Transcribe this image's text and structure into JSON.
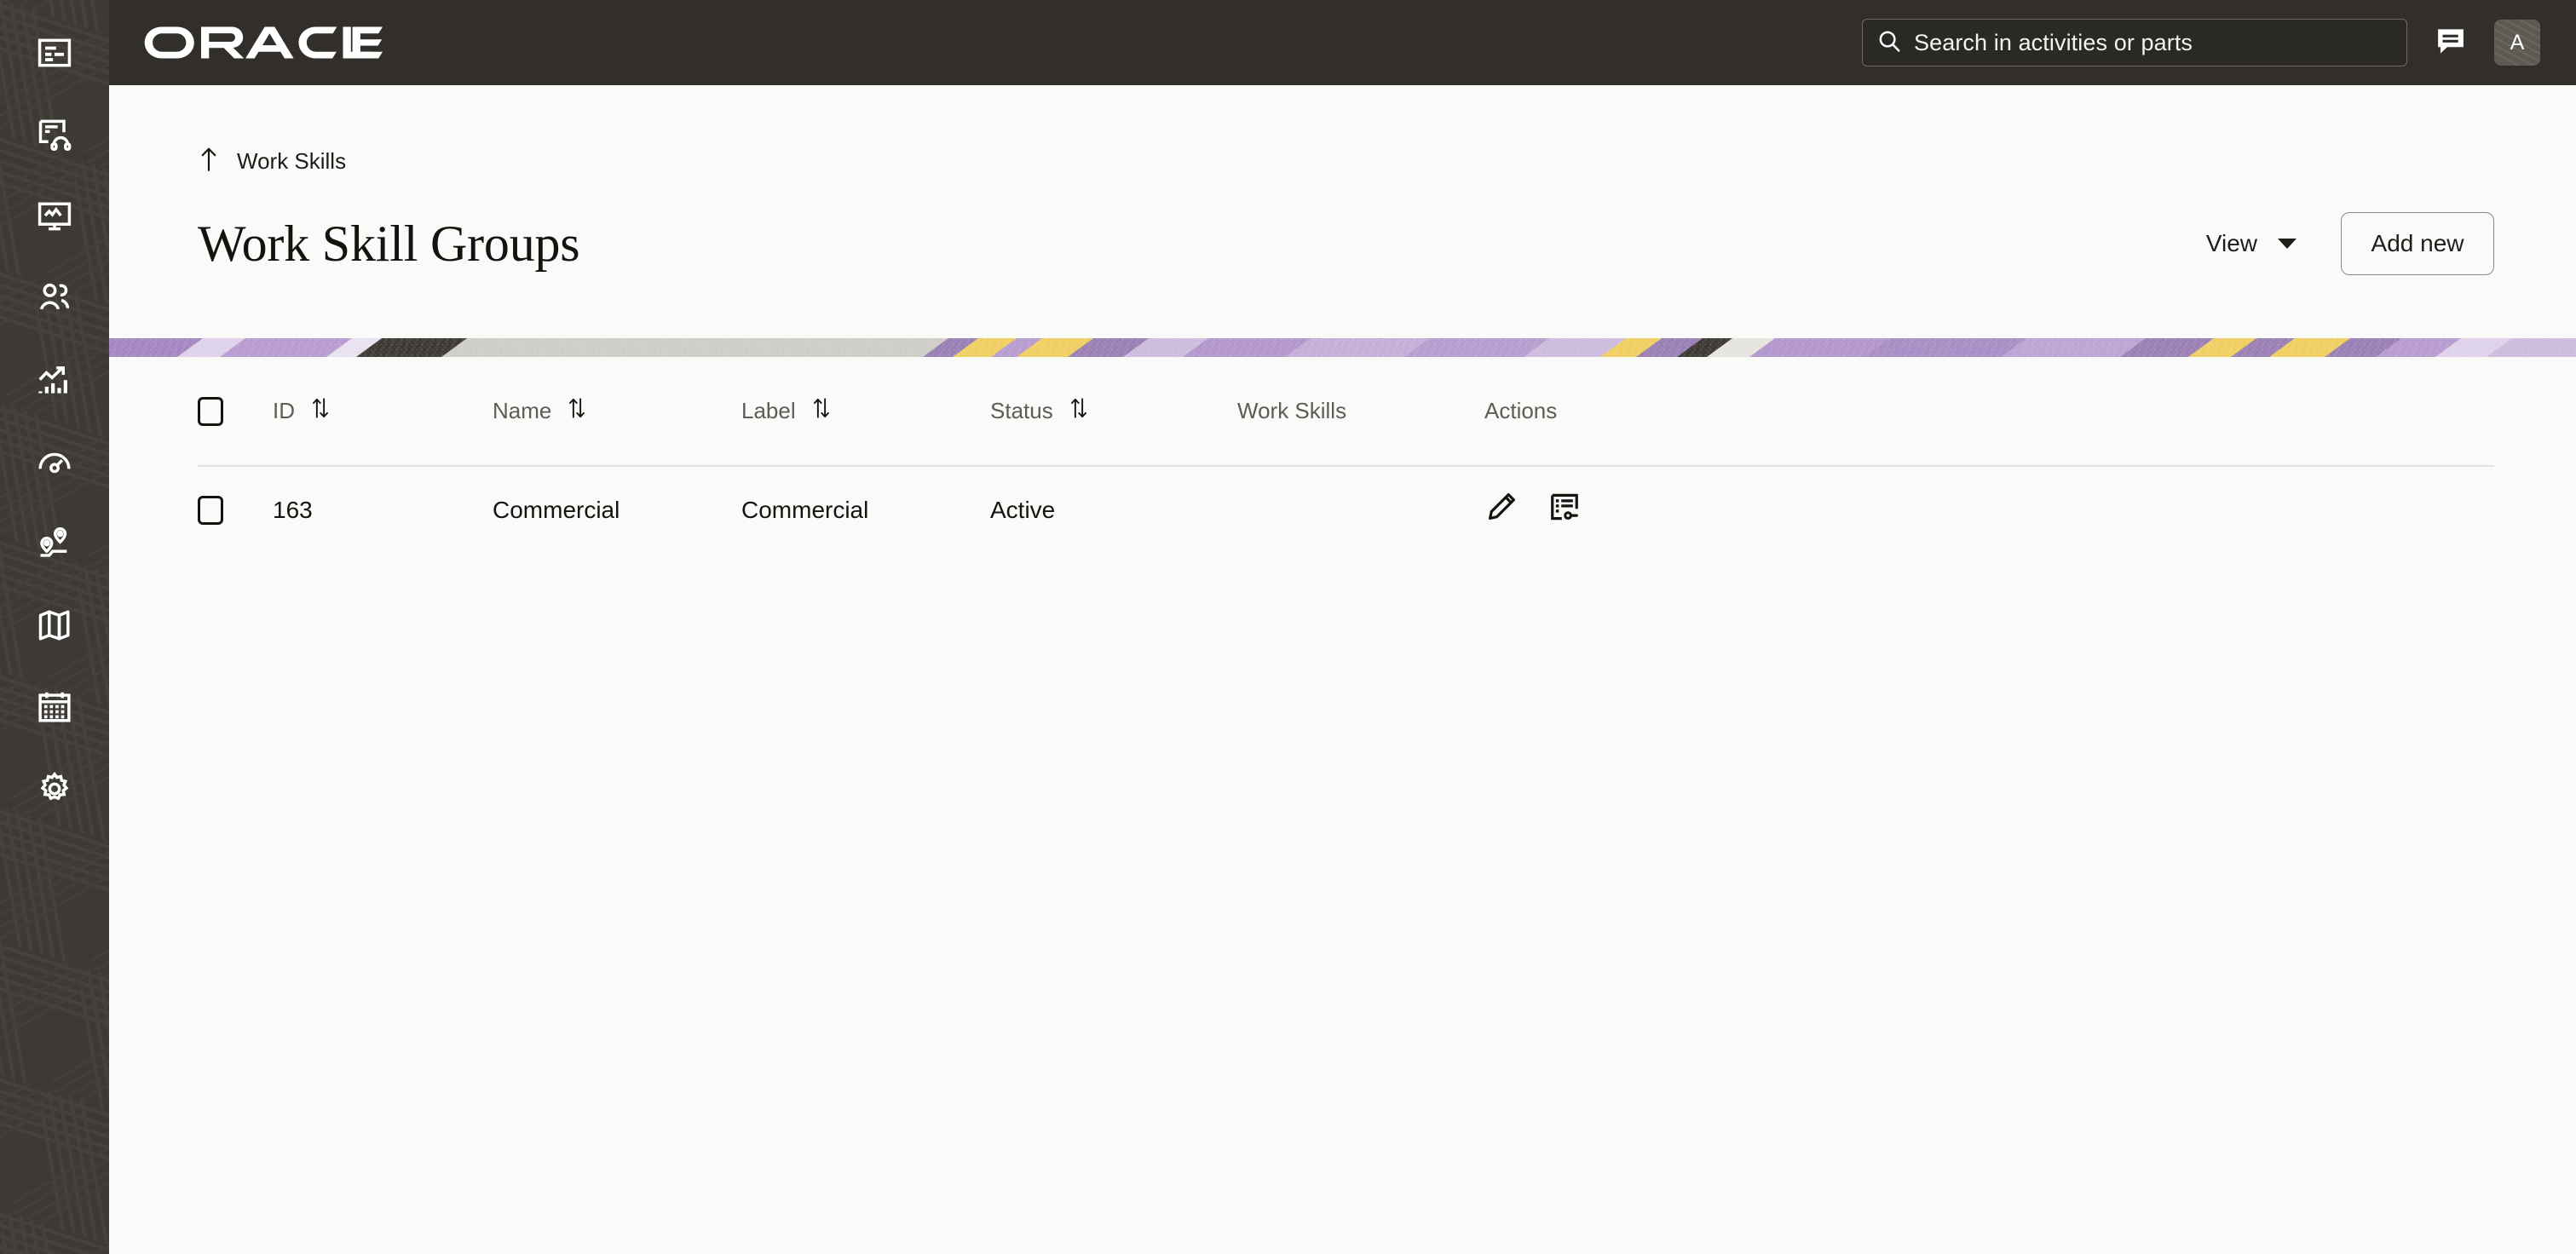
{
  "theme": {
    "sidebar_bg": "#3d3a35",
    "topbar_bg": "#322f2b",
    "page_bg": "#fafaf9",
    "text_primary": "#15130f",
    "text_muted": "#5f5c57",
    "banner_purple": "#9a7fb4",
    "banner_lavender": "#cdbcdd",
    "banner_yellow": "#f0cf62",
    "banner_dark": "#3c3935",
    "banner_gray": "#cfcdc8"
  },
  "sidebar": {
    "items": [
      {
        "name": "dispatch-console",
        "icon": "dispatch-icon"
      },
      {
        "name": "service-requests",
        "icon": "headset-document-icon"
      },
      {
        "name": "monitoring",
        "icon": "monitor-activity-icon"
      },
      {
        "name": "resources",
        "icon": "users-icon"
      },
      {
        "name": "analytics",
        "icon": "trending-chart-icon"
      },
      {
        "name": "performance",
        "icon": "gauge-icon"
      },
      {
        "name": "routing",
        "icon": "route-pins-icon"
      },
      {
        "name": "map",
        "icon": "map-icon"
      },
      {
        "name": "calendar",
        "icon": "calendar-icon"
      },
      {
        "name": "configuration",
        "icon": "gear-icon"
      }
    ]
  },
  "topbar": {
    "brand": "ORACLE",
    "search": {
      "placeholder": "Search in activities or parts",
      "value": "Search in activities or parts",
      "icon": "search-icon"
    },
    "chat": {
      "icon": "chat-icon",
      "label": "Collaboration"
    },
    "avatar": {
      "initial": "A",
      "label": "User menu"
    }
  },
  "page": {
    "breadcrumb": {
      "icon": "arrow-up-icon",
      "label": "Work Skills"
    },
    "title": "Work Skill Groups",
    "view_menu": {
      "label": "View",
      "icon": "caret-down-icon"
    },
    "add_new": {
      "label": "Add new"
    }
  },
  "table": {
    "columns": [
      {
        "key": "check",
        "label": "",
        "sortable": false
      },
      {
        "key": "id",
        "label": "ID",
        "sortable": true
      },
      {
        "key": "name",
        "label": "Name",
        "sortable": true
      },
      {
        "key": "label",
        "label": "Label",
        "sortable": true
      },
      {
        "key": "status",
        "label": "Status",
        "sortable": true
      },
      {
        "key": "skills",
        "label": "Work Skills",
        "sortable": false
      },
      {
        "key": "actions",
        "label": "Actions",
        "sortable": false
      }
    ],
    "rows": [
      {
        "id": "163",
        "name": "Commercial",
        "label": "Commercial",
        "status": "Active",
        "skills": "",
        "selected": false,
        "actions": [
          {
            "name": "edit-action",
            "icon": "pencil-icon"
          },
          {
            "name": "properties-action",
            "icon": "list-properties-icon"
          }
        ]
      }
    ]
  }
}
